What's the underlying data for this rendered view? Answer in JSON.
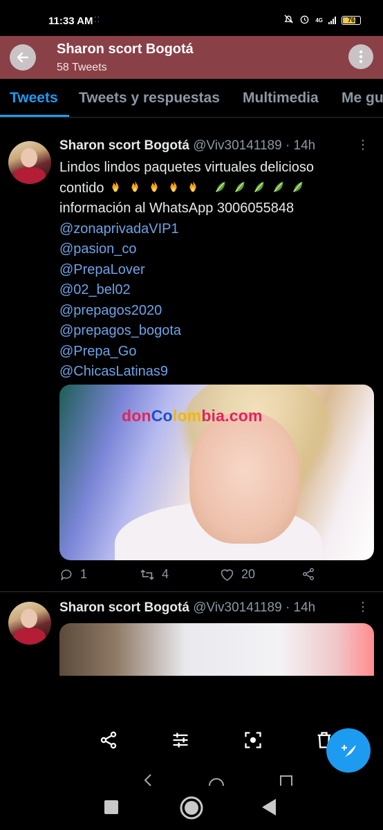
{
  "status_bar": {
    "time": "11:33 AM",
    "battery": "76",
    "network": "4G"
  },
  "header": {
    "title": "Sharon scort Bogotá",
    "subtitle": "58 Tweets"
  },
  "tabs": [
    {
      "label": "Tweets",
      "active": true
    },
    {
      "label": "Tweets y respuestas",
      "active": false
    },
    {
      "label": "Multimedia",
      "active": false
    },
    {
      "label": "Me gu",
      "active": false
    }
  ],
  "tweet1": {
    "name": "Sharon scort Bogotá",
    "handle": "@Viv30141189",
    "time": "· 14h",
    "line1": "Lindos lindos paquetes virtuales delicioso",
    "line2": "contido",
    "line3": "información al WhatsApp 3006055848",
    "mentions": [
      "@zonaprivadaVIP1",
      "@pasion_co",
      "@PrepaLover",
      "@02_bel02",
      "@prepagos2020",
      "@prepagos_bogota",
      "@Prepa_Go",
      "@ChicasLatinas9"
    ],
    "watermark": {
      "don": "don",
      "co": "Co",
      "lom": "lom",
      "bia": "bia.com"
    },
    "replies": "1",
    "retweets": "4",
    "likes": "20"
  },
  "tweet2": {
    "name": "Sharon scort Bogotá",
    "handle": "@Viv30141189",
    "time": "· 14h"
  },
  "colors": {
    "accent": "#1d9bf0",
    "header_bg": "#8a4047",
    "mention": "#6ea3e6"
  }
}
